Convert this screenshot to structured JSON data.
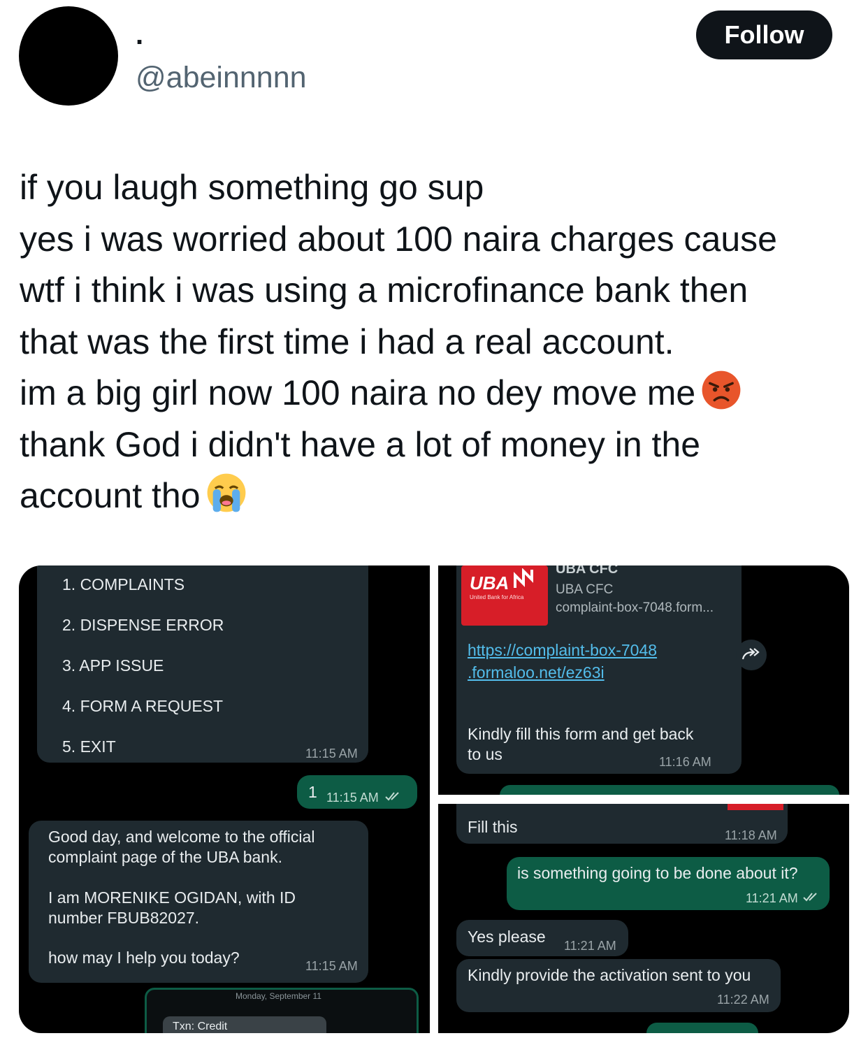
{
  "author": {
    "display_name": ".",
    "handle": "@abeinnnnn"
  },
  "follow_label": "Follow",
  "tweet": {
    "lines": [
      "if you laugh something go sup",
      "yes i was worried about 100 naira charges cause",
      "wtf i think i was using a microfinance bank then",
      "that was the first time i had a real account.",
      "im a big girl now 100 naira no dey move me",
      "thank God i didn't have a lot of money in the",
      "account tho"
    ],
    "emojis": [
      "angry-face-emoji",
      "loudly-crying-face-emoji"
    ]
  },
  "screenshots": {
    "left": {
      "menu": [
        "1. COMPLAINTS",
        "2. DISPENSE ERROR",
        "3. APP ISSUE",
        "4. FORM A REQUEST",
        "5. EXIT"
      ],
      "menu_time": "11:15 AM",
      "reply_text": "1",
      "reply_time": "11:15 AM",
      "welcome_line1": "Good day, and welcome to the official",
      "welcome_line2": "complaint page of the UBA bank.",
      "agent_line1": "I am MORENIKE OGIDAN, with ID",
      "agent_line2": "number FBUB82027.",
      "help_line": "how may I help you today?",
      "welcome_time": "11:15 AM",
      "date_label": "Monday, September 11",
      "txn_label": "Txn: Credit"
    },
    "top_right": {
      "preview_title": "UBA CFC",
      "preview_site": "UBA CFC",
      "preview_url": "complaint-box-7048.form...",
      "logo_text": "UBA",
      "logo_subtext": "United Bank for Africa",
      "link_line1": "https://complaint-box-7048",
      "link_line2": ".formaloo.net/ez63i",
      "note_line1": "Kindly fill this form and get back",
      "note_line2": "to us",
      "note_time": "11:16 AM"
    },
    "bottom_right": {
      "fill_text": "Fill this",
      "fill_time": "11:18 AM",
      "question": "is something going to be done about it?",
      "question_time": "11:21 AM",
      "yes_text": "Yes please",
      "yes_time": "11:21 AM",
      "activation_text": "Kindly provide the activation sent to you",
      "activation_time": "11:22 AM"
    }
  },
  "colors": {
    "accent_text": "#0f1419",
    "secondary_text": "#536471",
    "chat_incoming": "#1f2a30",
    "chat_outgoing": "#0d5c45",
    "link": "#53bdeb",
    "uba_red": "#d71e28"
  }
}
